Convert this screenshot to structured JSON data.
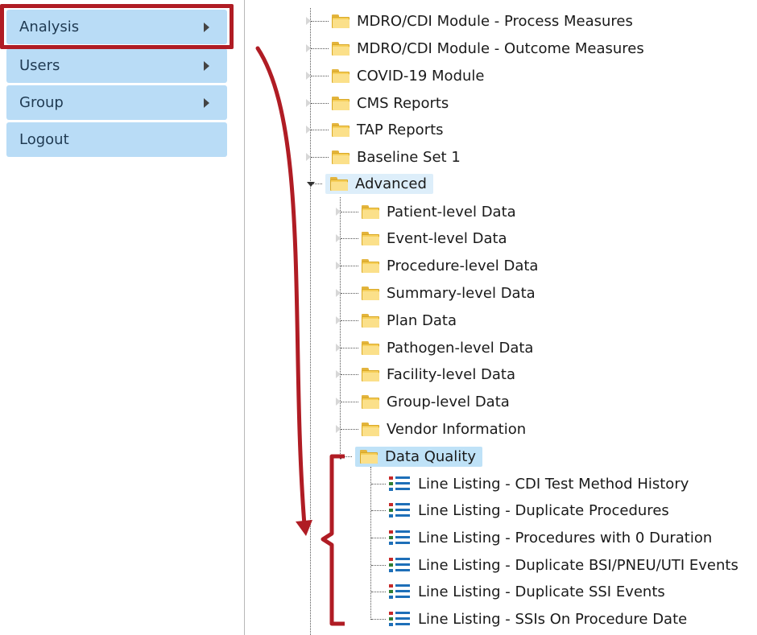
{
  "menu": {
    "items": [
      {
        "label": "Analysis",
        "has_submenu": true
      },
      {
        "label": "Users",
        "has_submenu": true
      },
      {
        "label": "Group",
        "has_submenu": true
      },
      {
        "label": "Logout",
        "has_submenu": false
      }
    ]
  },
  "tree": {
    "top_folders": [
      "MDRO/CDI Module - Process Measures",
      "MDRO/CDI Module - Outcome Measures",
      "COVID-19 Module",
      "CMS Reports",
      "TAP Reports",
      "Baseline Set 1"
    ],
    "advanced": {
      "label": "Advanced",
      "children": [
        "Patient-level Data",
        "Event-level Data",
        "Procedure-level Data",
        "Summary-level Data",
        "Plan Data",
        "Pathogen-level Data",
        "Facility-level Data",
        "Group-level Data",
        "Vendor Information"
      ],
      "data_quality": {
        "label": "Data Quality",
        "reports": [
          "Line Listing - CDI Test Method History",
          "Line Listing - Duplicate Procedures",
          "Line Listing - Procedures with 0 Duration",
          "Line Listing - Duplicate BSI/PNEU/UTI Events",
          "Line Listing - Duplicate SSI Events",
          "Line Listing - SSIs On Procedure Date"
        ]
      }
    }
  },
  "colors": {
    "menu_bg": "#b9dcf6",
    "annotation": "#b01c24",
    "folder": "#f6cf5a",
    "selected_bg": "#bfe2f7"
  }
}
